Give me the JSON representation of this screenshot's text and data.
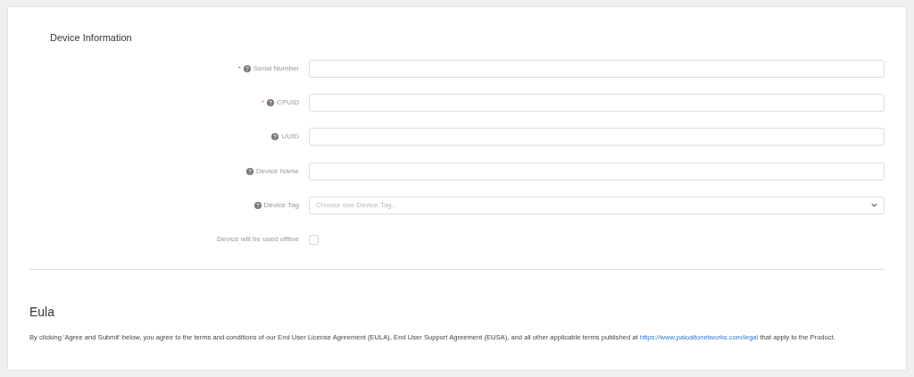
{
  "section_title": "Device Information",
  "fields": [
    {
      "kind": "text",
      "label": "Serial Number",
      "required_mark": "*",
      "help": true
    },
    {
      "kind": "text",
      "label": "CPUID",
      "required_mark": "*",
      "help": true
    },
    {
      "kind": "text",
      "label": "UUID",
      "help": true
    },
    {
      "kind": "text",
      "label": "Device Name",
      "help": true
    },
    {
      "kind": "select",
      "label": "Device Tag",
      "help": true,
      "placeholder": "Choose one Device Tag..."
    },
    {
      "kind": "checkbox",
      "label": "Device will be used offline",
      "help": false,
      "checked": false
    }
  ],
  "eula": {
    "title": "Eula",
    "text_before": "By clicking 'Agree and Submit' below, you agree to the terms and conditions of our End User License Agreement (EULA), End User Support Agreement (EUSA), and all other applicable terms published at",
    "link": "https://www.paloaltonetworks.com/legal",
    "text_after": "that apply to the Product."
  }
}
